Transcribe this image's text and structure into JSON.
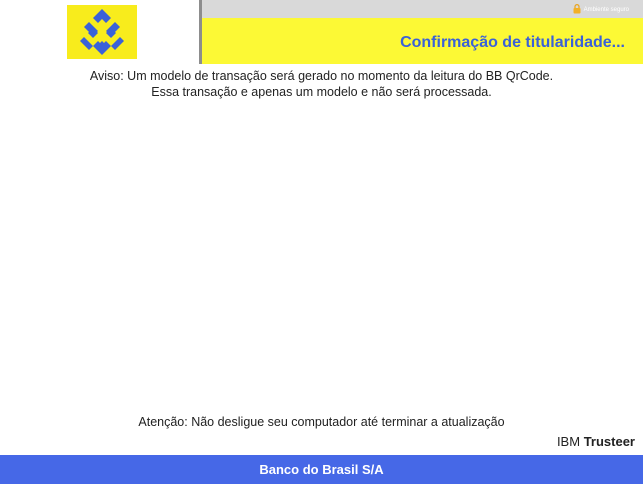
{
  "header": {
    "secure_label": "Ambiente seguro",
    "title": "Confirmação de titularidade..."
  },
  "notice": {
    "line1": "Aviso: Um modelo de transação será gerado no momento da leitura do BB QrCode.",
    "line2": "Essa transação e apenas um modelo e não será processada."
  },
  "warning": "Atenção: Não desligue seu computador até terminar a atualização",
  "brand_badge": {
    "prefix": "IBM",
    "name": "Trusteer"
  },
  "footer": "Banco do Brasil S/A",
  "colors": {
    "logo_yellow": "#f8ec1c",
    "header_yellow": "#fcf935",
    "brand_blue": "#3a61d8",
    "footer_blue": "#4668e7"
  },
  "icons": {
    "logo": "banco-do-brasil-logo",
    "lock": "lock-icon"
  }
}
